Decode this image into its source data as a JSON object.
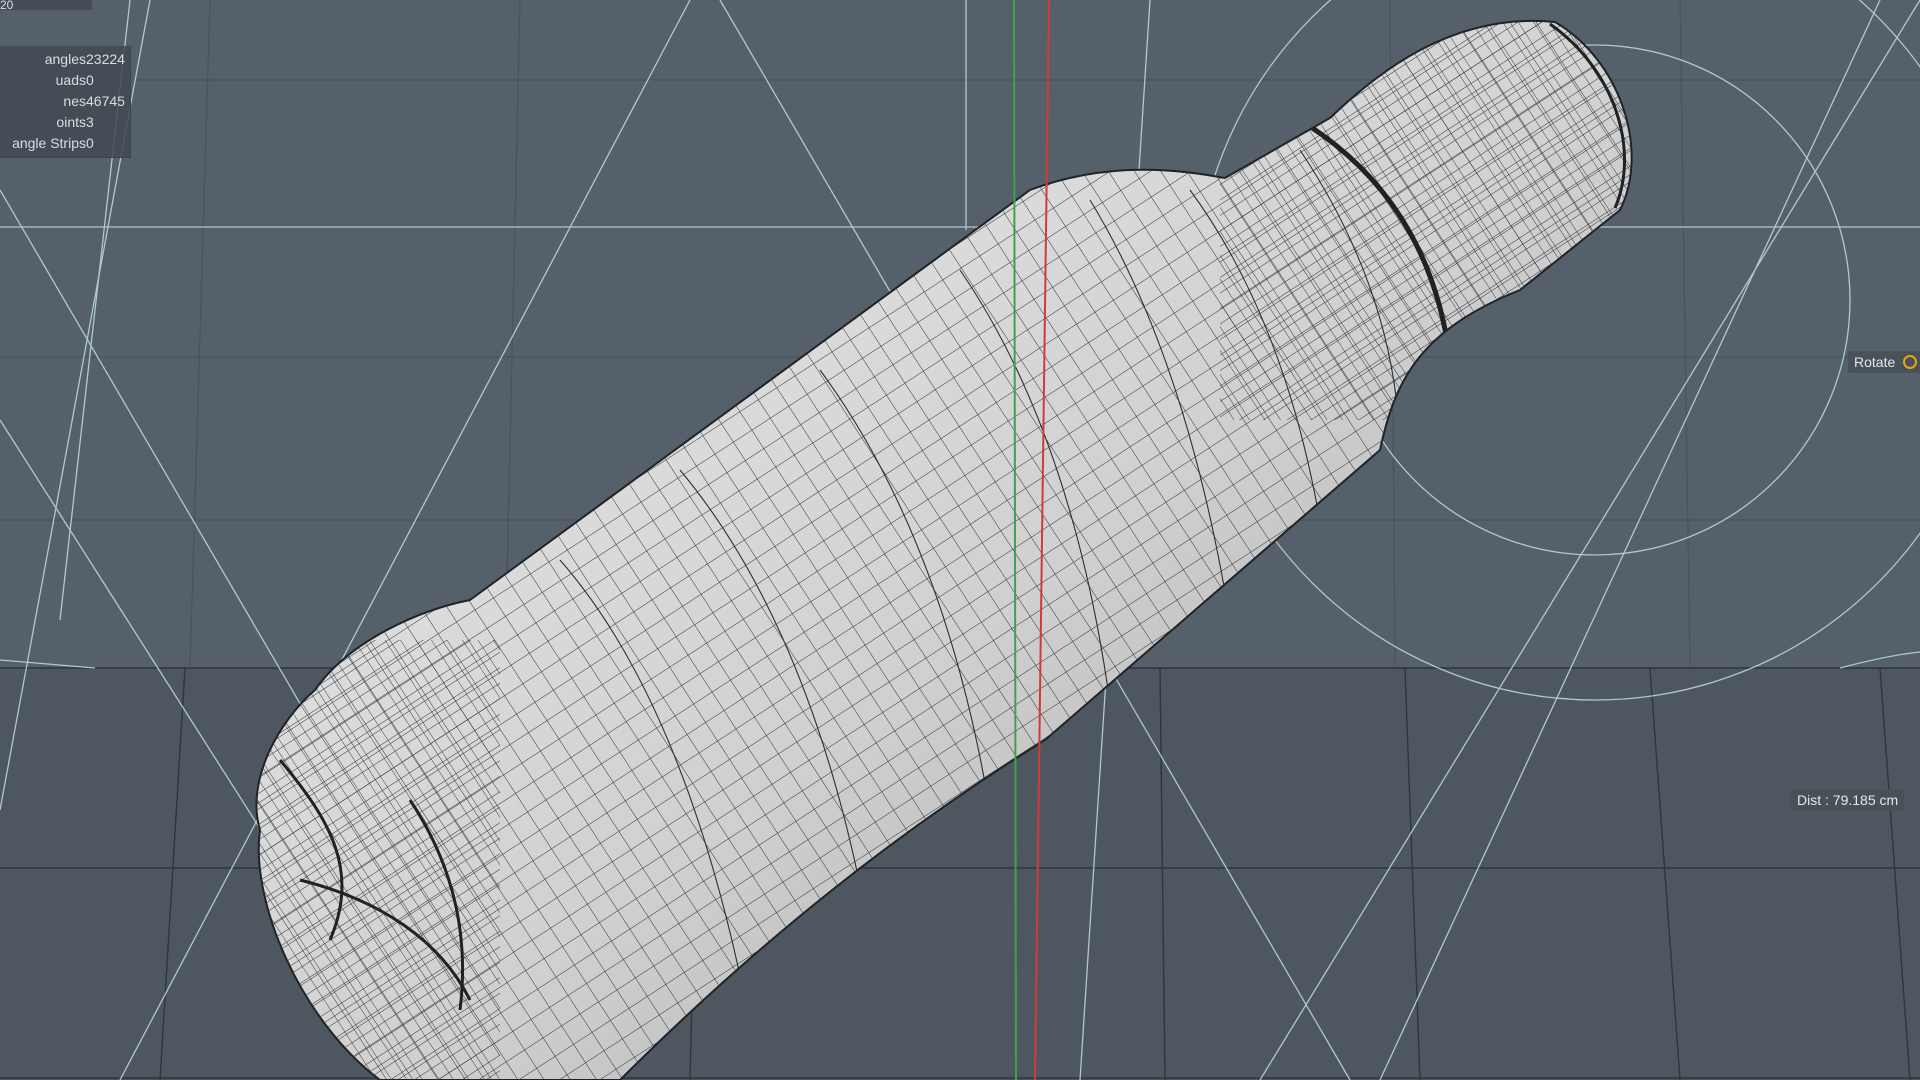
{
  "viewport": {
    "background": "#56606a",
    "model": "wireframe bottle",
    "axes": {
      "x_color": "#d23a3a",
      "y_color": "#3fa24a"
    },
    "guide_color": "#b8d6d8",
    "mesh_fill": "#d6d6d6",
    "mesh_wire": "#2e3236"
  },
  "stats_panel": {
    "header_fragment": "20",
    "rows": [
      {
        "label": "angles",
        "value": "23224"
      },
      {
        "label": "uads",
        "value": "0"
      },
      {
        "label": "nes",
        "value": "46745"
      },
      {
        "label": "oints",
        "value": "3"
      },
      {
        "label": "angle Strips",
        "value": "0"
      }
    ]
  },
  "hud": {
    "rotate_label": "Rotate",
    "rotate_icon": "orange-ring-icon",
    "distance_label": "Dist : 79.185 cm"
  }
}
